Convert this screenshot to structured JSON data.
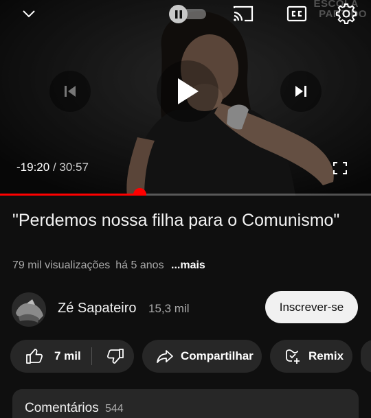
{
  "player": {
    "watermark": "ESCOLA\nPARTIDO",
    "remaining": "-19:20",
    "total": "/ 30:57",
    "progress_fraction": 0.376,
    "icons": [
      "chevron-down-icon",
      "pause-icon",
      "cast-icon",
      "captions-icon",
      "gear-icon",
      "previous-icon",
      "play-icon",
      "next-icon",
      "fullscreen-icon"
    ],
    "accent": "#ff0000"
  },
  "video": {
    "title": "\"Perdemos nossa filha para o Comunismo\"",
    "views": "79 mil visualizações",
    "age": "há 5 anos",
    "more": "...mais"
  },
  "channel": {
    "name": "Zé Sapateiro",
    "subscribers": "15,3 mil",
    "subscribe_label": "Inscrever-se"
  },
  "actions": {
    "like_count": "7 mil",
    "share_label": "Compartilhar",
    "remix_label": "Remix"
  },
  "comments": {
    "label": "Comentários",
    "count": "544"
  }
}
